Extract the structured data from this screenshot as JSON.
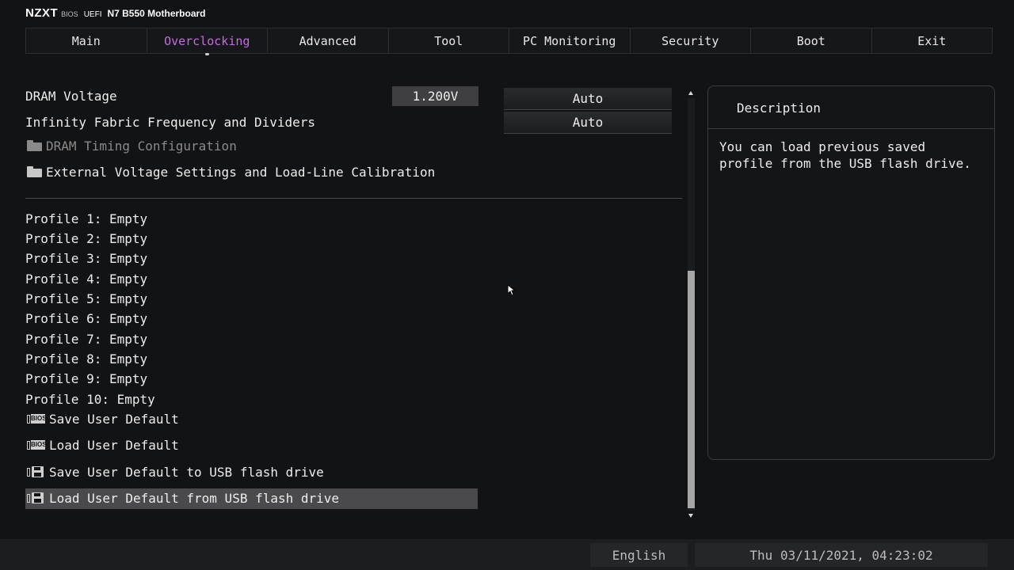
{
  "header": {
    "brand": "NZXT",
    "bios": "BIOS",
    "uefi": "UEFI",
    "model": "N7 B550 Motherboard"
  },
  "tabs": [
    {
      "label": "Main"
    },
    {
      "label": "Overclocking",
      "active": true
    },
    {
      "label": "Advanced"
    },
    {
      "label": "Tool"
    },
    {
      "label": "PC Monitoring"
    },
    {
      "label": "Security"
    },
    {
      "label": "Boot"
    },
    {
      "label": "Exit"
    }
  ],
  "settings": {
    "dram_voltage": {
      "label": "DRAM Voltage",
      "value": "1.200V",
      "option": "Auto"
    },
    "infinity_fabric": {
      "label": "Infinity Fabric Frequency and Dividers",
      "option": "Auto"
    },
    "dram_timing": {
      "label": "DRAM Timing Configuration",
      "icon": "folder-icon",
      "disabled": true
    },
    "external_voltage": {
      "label": "External Voltage Settings and Load-Line Calibration",
      "icon": "folder-icon"
    }
  },
  "profiles": [
    "Profile 1: Empty",
    "Profile 2: Empty",
    "Profile 3: Empty",
    "Profile 4: Empty",
    "Profile 5: Empty",
    "Profile 6: Empty",
    "Profile 7: Empty",
    "Profile 8: Empty",
    "Profile 9: Empty",
    "Profile 10: Empty"
  ],
  "actions": [
    {
      "label": "Save User Default",
      "icon": "bios-chip-icon"
    },
    {
      "label": "Load User Default",
      "icon": "bios-chip-icon"
    },
    {
      "label": "Save User Default to USB flash drive",
      "icon": "floppy-disk-icon"
    },
    {
      "label": "Load User Default from USB flash drive",
      "icon": "floppy-disk-icon",
      "selected": true
    }
  ],
  "description": {
    "title": "Description",
    "text": "You can load previous saved profile from the USB flash drive."
  },
  "footer": {
    "language": "English",
    "datetime": "Thu 03/11/2021, 04:23:02"
  },
  "colors": {
    "background": "#121315",
    "accent": "#c46ddc",
    "selected_row": "#4a4a4c"
  }
}
